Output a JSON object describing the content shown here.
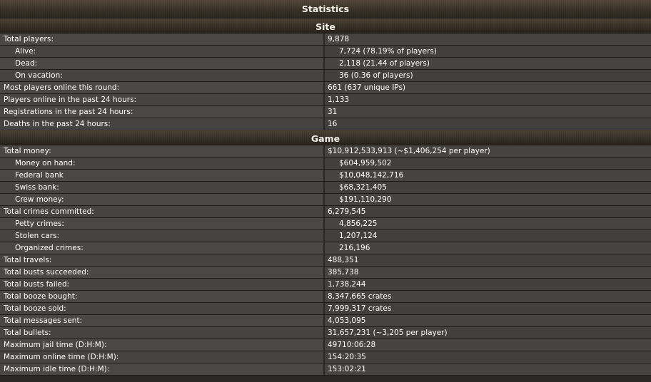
{
  "page": {
    "title": "Statistics"
  },
  "site": {
    "heading": "Site",
    "rows": [
      {
        "label": "Total players:",
        "value": "9,878",
        "sub": false
      },
      {
        "label": "Alive:",
        "value": "7,724 (78.19% of players)",
        "sub": true
      },
      {
        "label": "Dead:",
        "value": "2,118 (21.44 of players)",
        "sub": true
      },
      {
        "label": "On vacation:",
        "value": "36 (0.36 of players)",
        "sub": true
      },
      {
        "label": "Most players online this round:",
        "value": "661 (637 unique IPs)",
        "sub": false
      },
      {
        "label": "Players online in the past 24 hours:",
        "value": "1,133",
        "sub": false
      },
      {
        "label": "Registrations in the past 24 hours:",
        "value": "31",
        "sub": false
      },
      {
        "label": "Deaths in the past 24 hours:",
        "value": "16",
        "sub": false
      }
    ]
  },
  "game": {
    "heading": "Game",
    "rows": [
      {
        "label": "Total money:",
        "value": "$10,912,533,913 (~$1,406,254 per player)",
        "sub": false
      },
      {
        "label": "Money on hand:",
        "value": "$604,959,502",
        "sub": true
      },
      {
        "label": "Federal bank",
        "value": "$10,048,142,716",
        "sub": true
      },
      {
        "label": "Swiss bank:",
        "value": "$68,321,405",
        "sub": true
      },
      {
        "label": "Crew money:",
        "value": "$191,110,290",
        "sub": true
      },
      {
        "label": "Total crimes committed:",
        "value": "6,279,545",
        "sub": false
      },
      {
        "label": "Petty crimes:",
        "value": "4,856,225",
        "sub": true
      },
      {
        "label": "Stolen cars:",
        "value": "1,207,124",
        "sub": true
      },
      {
        "label": "Organized crimes:",
        "value": "216,196",
        "sub": true
      },
      {
        "label": "Total travels:",
        "value": "488,351",
        "sub": false
      },
      {
        "label": "Total busts succeeded:",
        "value": "385,738",
        "sub": false
      },
      {
        "label": "Total busts failed:",
        "value": "1,738,244",
        "sub": false
      },
      {
        "label": "Total booze bought:",
        "value": "8,347,665 crates",
        "sub": false
      },
      {
        "label": "Total booze sold:",
        "value": "7,999,317 crates",
        "sub": false
      },
      {
        "label": "Total messages sent:",
        "value": "4,053,095",
        "sub": false
      },
      {
        "label": "Total bullets:",
        "value": "31,657,231 (~3,205 per player)",
        "sub": false
      },
      {
        "label": "Maximum jail time (D:H:M):",
        "value": "49710:06:28",
        "sub": false
      },
      {
        "label": "Maximum online time (D:H:M):",
        "value": "154:20:35",
        "sub": false
      },
      {
        "label": "Maximum idle time (D:H:M):",
        "value": "153:02:21",
        "sub": false
      }
    ]
  }
}
